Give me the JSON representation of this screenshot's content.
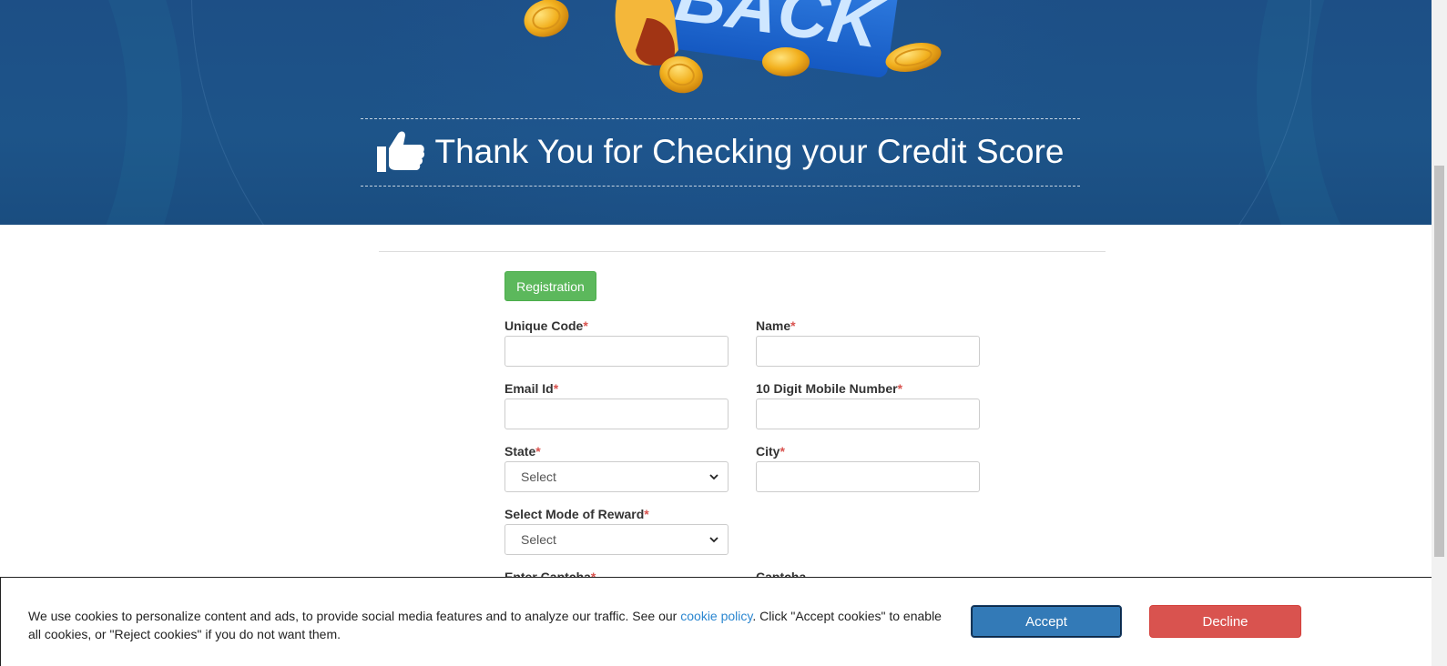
{
  "hero": {
    "banner_text": "BACK",
    "title": "Thank You for Checking your Credit Score",
    "title_icon": "thumbs-up-icon"
  },
  "form": {
    "section_button": "Registration",
    "required_mark": "*",
    "fields": {
      "unique_code": {
        "label": "Unique Code",
        "value": "",
        "placeholder": ""
      },
      "name": {
        "label": "Name",
        "value": "",
        "placeholder": ""
      },
      "email": {
        "label": "Email Id",
        "value": "",
        "placeholder": ""
      },
      "mobile": {
        "label": "10 Digit Mobile Number",
        "value": "",
        "placeholder": ""
      },
      "state": {
        "label": "State",
        "selected": "Select"
      },
      "city": {
        "label": "City",
        "value": "",
        "placeholder": ""
      },
      "reward_mode": {
        "label": "Select Mode of Reward",
        "selected": "Select"
      },
      "captcha_input": {
        "label": "Enter Captcha"
      },
      "captcha": {
        "label": "Captcha"
      }
    }
  },
  "cookie_bar": {
    "text_before": "We use cookies to personalize content and ads, to provide social media features and to analyze our traffic. See our ",
    "link_text": "cookie policy",
    "text_after": ". Click \"Accept cookies\" to enable all cookies, or \"Reject cookies\" if you do not want them.",
    "accept_label": "Accept",
    "decline_label": "Decline"
  },
  "colors": {
    "hero_bg": "#1d5489",
    "success": "#5cb85c",
    "primary": "#337ab7",
    "danger": "#d9534f",
    "required": "#d9534f",
    "link": "#2a86d0"
  }
}
